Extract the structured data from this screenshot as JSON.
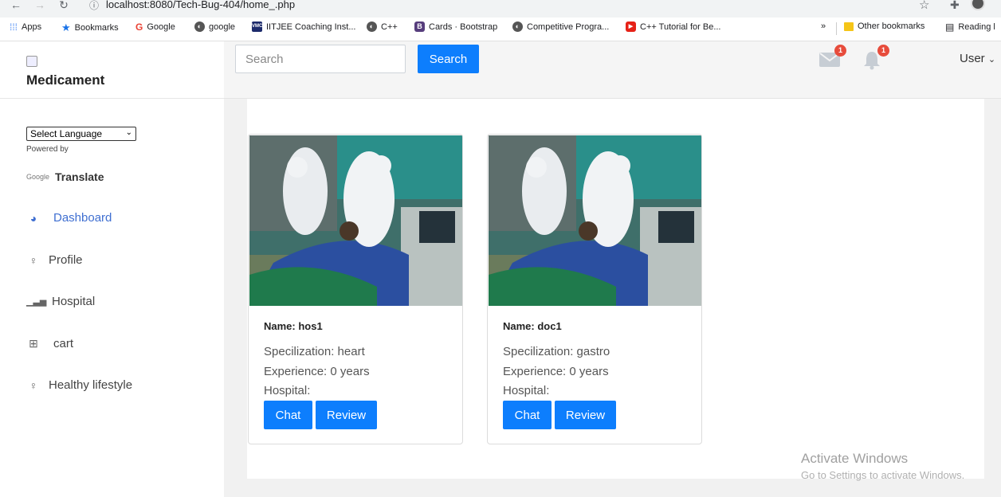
{
  "browser": {
    "url": "localhost:8080/Tech-Bug-404/home_.php",
    "bookmarks": [
      "Apps",
      "Bookmarks",
      "Google",
      "google",
      "IITJEE Coaching Inst...",
      "C++",
      "Cards · Bootstrap",
      "Competitive Progra...",
      "C++ Tutorial for Be..."
    ],
    "more": "»",
    "other_bookmarks": "Other bookmarks",
    "reading": "Reading l"
  },
  "sidebar": {
    "brand": "Medicament",
    "language_select": "Select Language",
    "powered_by": "Powered by",
    "google": "Google",
    "translate": "Translate",
    "items": [
      {
        "label": "Dashboard",
        "icon": "dashboard-icon"
      },
      {
        "label": "Profile",
        "icon": "bulb-icon"
      },
      {
        "label": "Hospital",
        "icon": "bar-chart-icon"
      },
      {
        "label": "cart",
        "icon": "basket-icon"
      },
      {
        "label": "Healthy lifestyle",
        "icon": "bulb-icon"
      }
    ]
  },
  "topbar": {
    "search_placeholder": "Search",
    "search_button": "Search",
    "mail_count": "1",
    "notif_count": "1",
    "user": "User"
  },
  "cards": [
    {
      "name": "Name: hos1",
      "spec": "Specilization: heart",
      "exp": "Experience: 0 years",
      "hospital": "Hospital:",
      "chat": "Chat",
      "review": "Review"
    },
    {
      "name": "Name: doc1",
      "spec": "Specilization: gastro",
      "exp": "Experience: 0 years",
      "hospital": "Hospital:",
      "chat": "Chat",
      "review": "Review"
    }
  ],
  "watermark": {
    "line1": "Activate Windows",
    "line2": "Go to Settings to activate Windows."
  },
  "colors": {
    "accent": "#0d7efd",
    "active_nav": "#3f6fd1",
    "badge": "#e74c3c"
  }
}
